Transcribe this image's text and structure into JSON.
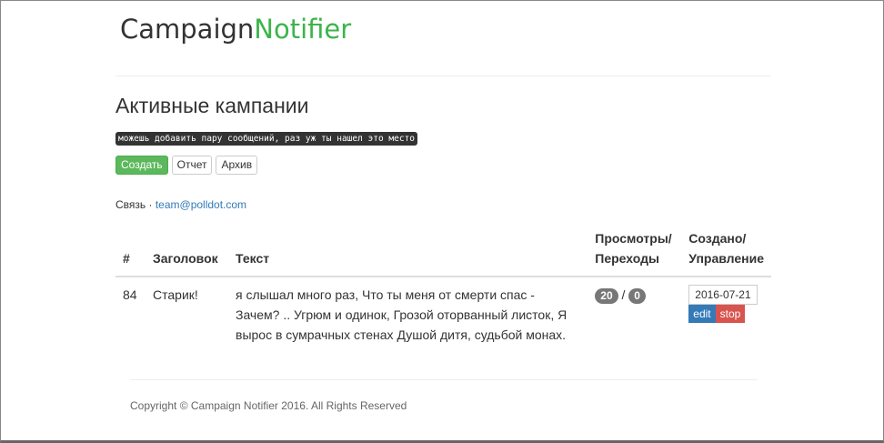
{
  "brand": {
    "part1": "Campaign",
    "part2": "Notifier"
  },
  "title": "Активные кампании",
  "hint": "можешь добавить пару сообщений, раз уж ты нашел это место",
  "buttons": {
    "create": "Создать",
    "report": "Отчет",
    "archive": "Архив"
  },
  "contact": {
    "label": "Связь · ",
    "email": "team@polldot.com"
  },
  "table": {
    "headers": [
      "#",
      "Заголовок",
      "Текст",
      "Просмотры/ Переходы",
      "Создано/ Управление"
    ],
    "rows": [
      {
        "id": "84",
        "title": "Старик!",
        "text": "я слышал много раз, Что ты меня от смерти спас - Зачем? .. Угрюм и одинок, Грозой оторванный листок, Я вырос в сумрачных стенах Душой дитя, судьбой монах.",
        "views": "20",
        "sep": "/",
        "clicks": "0",
        "date": "2016-07-21",
        "edit": "edit",
        "stop": "stop"
      }
    ]
  },
  "footer": "Copyright © Campaign Notifier 2016. All Rights Reserved"
}
